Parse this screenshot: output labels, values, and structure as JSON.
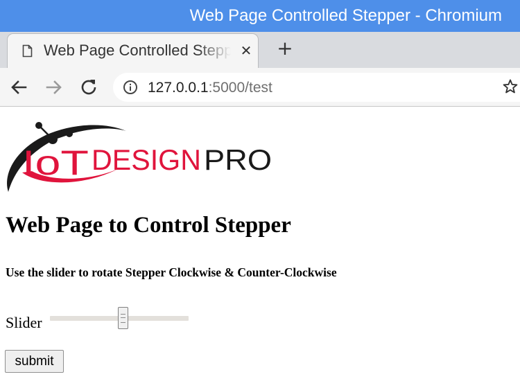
{
  "window": {
    "title": "Web Page Controlled Stepper - Chromium"
  },
  "tabs": [
    {
      "title": "Web Page Controlled Stepper",
      "favicon": "page-icon",
      "active": true
    }
  ],
  "toolbar": {
    "back_icon": "back-arrow-icon",
    "forward_icon": "forward-arrow-icon",
    "reload_icon": "reload-icon",
    "site_info_icon": "info-icon",
    "bookmark_icon": "star-icon",
    "new_tab_icon": "plus-icon",
    "close_tab_icon": "close-icon"
  },
  "address_bar": {
    "host": "127.0.0.1",
    "path": ":5000/test"
  },
  "page": {
    "logo": {
      "text_iot": "IoT",
      "text_design": "DESIGN",
      "text_pro": "PRO",
      "primary_color": "#e0143c",
      "secondary_color": "#1a1a1a"
    },
    "heading": "Web Page to Control Stepper",
    "subheading": "Use the slider to rotate Stepper Clockwise & Counter-Clockwise",
    "slider": {
      "label": "Slider",
      "min": 0,
      "max": 100,
      "value": 50
    },
    "submit_label": "submit"
  },
  "colors": {
    "titlebar": "#4e8fe9",
    "tabstrip": "#d9dbdf",
    "toolbar": "#f5f5f5"
  }
}
